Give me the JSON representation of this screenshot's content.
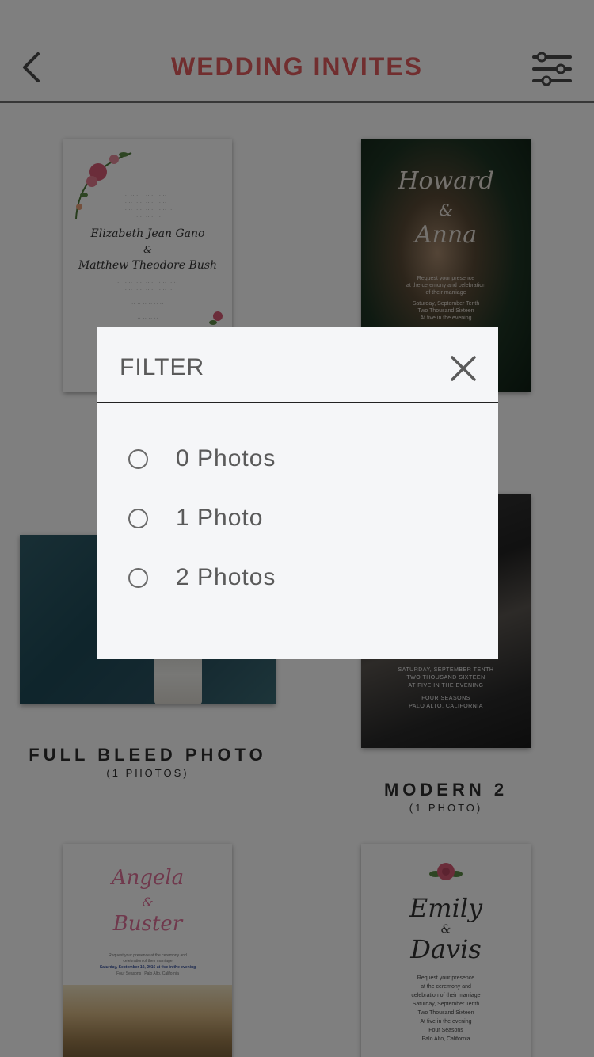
{
  "header": {
    "title": "WEDDING INVITES",
    "back_icon": "chevron-left-icon",
    "filter_icon": "sliders-icon"
  },
  "cards": {
    "floral": {
      "names": [
        "Elizabeth Jean Gano",
        "&",
        "Matthew Theodore Bush"
      ]
    },
    "howard_anna": {
      "names": [
        "Howard",
        "&",
        "Anna"
      ],
      "lines": [
        "Request your presence",
        "at the ceremony and celebration",
        "of their marriage",
        "Saturday, September Tenth",
        "Two Thousand Sixteen",
        "At five in the evening"
      ]
    },
    "full_bleed": {
      "label": "FULL BLEED PHOTO",
      "sub": "(1 PHOTOS)"
    },
    "modern2": {
      "label": "MODERN 2",
      "sub": "(1 PHOTO)",
      "lines": [
        "SATURDAY, SEPTEMBER TENTH",
        "TWO THOUSAND SIXTEEN",
        "AT FIVE IN THE EVENING",
        "FOUR SEASONS",
        "PALO ALTO, CALIFORNIA"
      ]
    },
    "angela_buster": {
      "names": [
        "Angela",
        "&",
        "Buster"
      ],
      "lines": [
        "Request your presence at the ceremony and",
        "celebration of their marriage",
        "Saturday, September 10, 2016 at five in the evening",
        "Four Seasons | Palo Alto, California"
      ]
    },
    "emily_davis": {
      "names": [
        "Emily",
        "&",
        "Davis"
      ],
      "lines": [
        "Request your presence",
        "at the ceremony and",
        "celebration of their marriage",
        "Saturday, September Tenth",
        "Two Thousand Sixteen",
        "At five in the evening",
        "Four Seasons",
        "Palo Alto, California"
      ]
    }
  },
  "dialog": {
    "title": "FILTER",
    "close_icon": "close-icon",
    "options": [
      {
        "label": "0 Photos",
        "selected": false
      },
      {
        "label": "1 Photo",
        "selected": false
      },
      {
        "label": "2 Photos",
        "selected": false
      }
    ]
  },
  "colors": {
    "accent": "#e25d5f",
    "overlay": "#000000"
  }
}
